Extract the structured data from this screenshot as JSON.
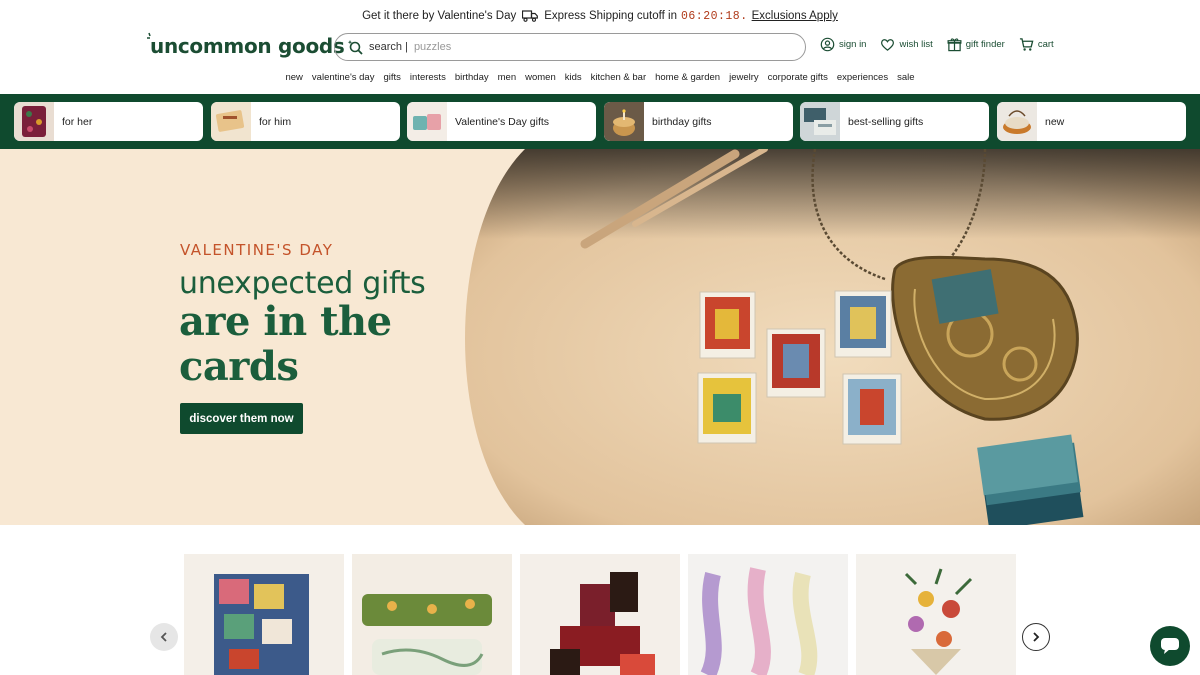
{
  "announcement": {
    "text_before": "Get it there by Valentine's Day",
    "text_after": "Express Shipping cutoff in",
    "timer": "06:20:18.",
    "exclusions_link": "Exclusions Apply"
  },
  "header": {
    "logo_text": "uncommon goods",
    "search_label": "search |",
    "search_placeholder": "puzzles",
    "links": {
      "sign_in": "sign in",
      "wish_list": "wish list",
      "gift_finder": "gift finder",
      "cart": "cart"
    }
  },
  "nav": [
    "new",
    "valentine's day",
    "gifts",
    "interests",
    "birthday",
    "men",
    "women",
    "kids",
    "kitchen & bar",
    "home & garden",
    "jewelry",
    "corporate gifts",
    "experiences",
    "sale"
  ],
  "categories": [
    {
      "label": "for her"
    },
    {
      "label": "for him"
    },
    {
      "label": "Valentine's Day gifts"
    },
    {
      "label": "birthday gifts"
    },
    {
      "label": "best-selling gifts"
    },
    {
      "label": "new"
    }
  ],
  "hero": {
    "eyebrow": "VALENTINE'S DAY",
    "line1": "unexpected gifts",
    "line2": "are in the cards",
    "cta": "discover them now"
  },
  "colors": {
    "brand_green": "#0f4a2e",
    "accent_orange": "#c4532a",
    "hero_bg": "#f8e8d3"
  }
}
